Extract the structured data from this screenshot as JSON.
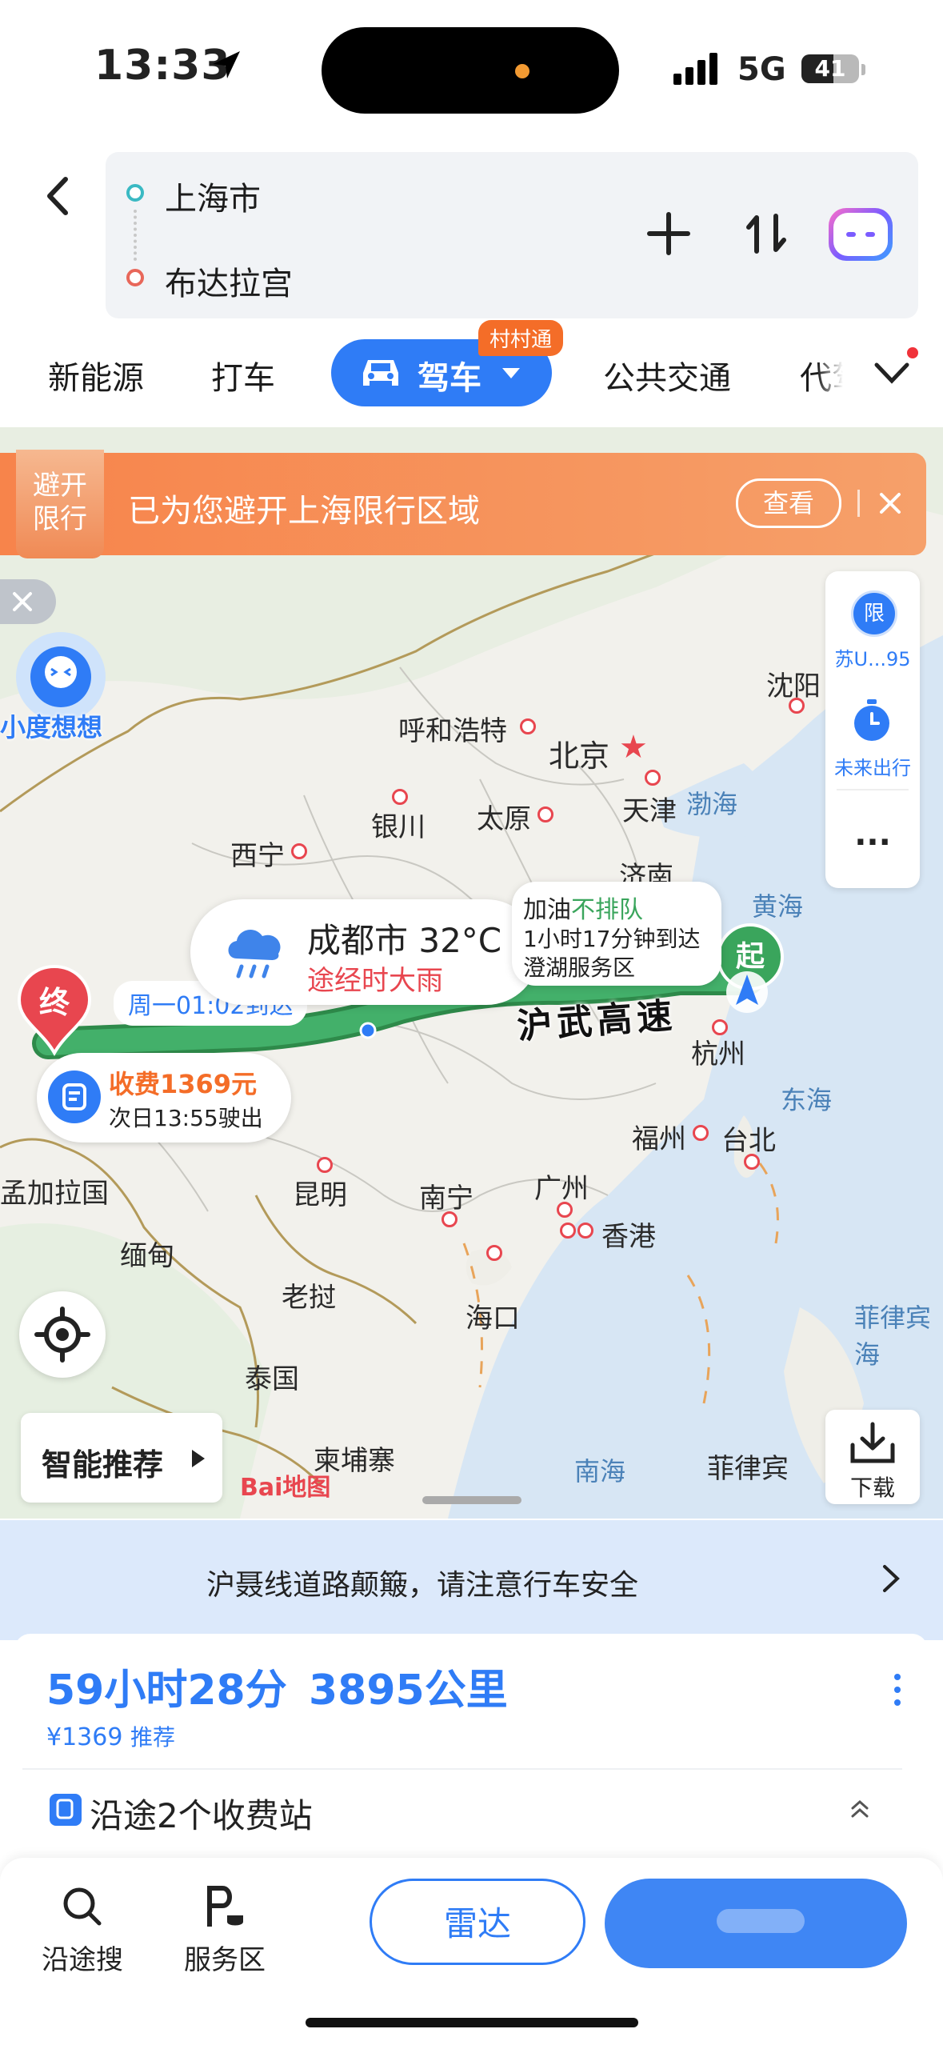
{
  "status_bar": {
    "time": "13:33",
    "network": "5G",
    "battery": "41"
  },
  "route": {
    "origin": "上海市",
    "destination": "布达拉宫"
  },
  "tabs": [
    {
      "label": "新能源"
    },
    {
      "label": "打车"
    },
    {
      "label": "驾车",
      "badge": "村村通",
      "active": true
    },
    {
      "label": "公共交通"
    },
    {
      "label": "代驾"
    }
  ],
  "banner": {
    "tag_line1": "避开",
    "tag_line2": "限行",
    "text": "已为您避开上海限行区域",
    "button": "查看"
  },
  "xiaodu": {
    "label": "小度想想"
  },
  "side_panel": {
    "restrict_label": "苏U...95",
    "restrict_icon_text": "限",
    "future_label": "未来出行",
    "more": "···"
  },
  "map": {
    "cities": [
      "呼和浩特",
      "北京",
      "天津",
      "沈阳",
      "银川",
      "太原",
      "西宁",
      "济南",
      "杭州",
      "福州",
      "台北",
      "昆明",
      "南宁",
      "广州",
      "香港",
      "海口",
      "缅甸",
      "老挝",
      "泰国",
      "柬埔寨",
      "孟加拉国",
      "菲律宾",
      "菲律宾海"
    ],
    "seas": [
      "渤海",
      "黄海",
      "东海",
      "南海"
    ],
    "highway": "沪武高速",
    "start_marker": "起",
    "end_marker": "终",
    "eta_label": "周一01:02到达",
    "toll": {
      "label": "收费1369元",
      "sub": "次日13:55驶出"
    },
    "weather": {
      "city_temp": "成都市 32°C",
      "condition": "途经时大雨"
    },
    "fuel": {
      "prefix": "加油",
      "highlight": "不排队",
      "line2": "1小时17分钟到达",
      "line3": "澄湖服务区"
    },
    "logo": "Bai地图",
    "smart_recommend": "智能推荐",
    "download": "下载"
  },
  "notice": {
    "text": "沪聂线道路颠簸，请注意行车安全"
  },
  "summary": {
    "duration": "59小时28分",
    "distance": "3895公里",
    "price": "¥1369",
    "price_tag": "推荐",
    "toll_stations": "沿途2个收费站"
  },
  "bottom": {
    "search_along": "沿途搜",
    "service_area": "服务区",
    "radar": "雷达"
  },
  "colors": {
    "accent": "#2f7cf6",
    "route_green": "#3aa55c",
    "orange": "#f46d28",
    "red_marker": "#e8464f"
  }
}
